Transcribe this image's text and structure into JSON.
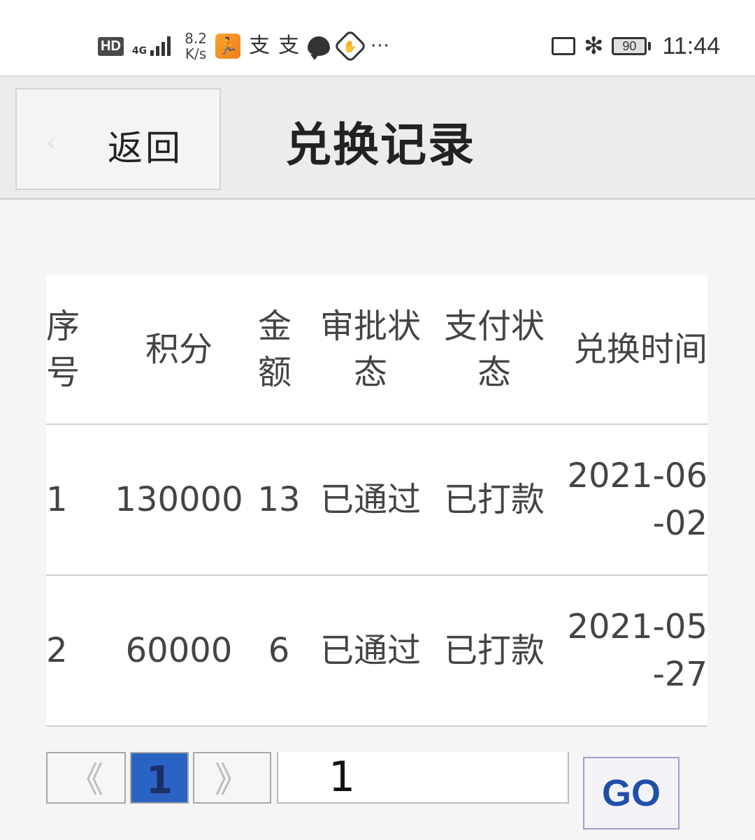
{
  "status_bar": {
    "hd": "HD",
    "network": "4G",
    "net_speed_value": "8.2",
    "net_speed_unit": "K/s",
    "app_glyph_1": "支",
    "app_glyph_2": "支",
    "more": "···",
    "battery": "90",
    "time": "11:44",
    "icons": [
      "hd-icon",
      "signal-icon",
      "running-app-icon",
      "alipay-icon",
      "alipay-icon",
      "chat-icon",
      "hand-icon",
      "more-icon",
      "cast-icon",
      "bluetooth-icon",
      "battery-icon"
    ]
  },
  "header": {
    "back_label": "返回",
    "title": "兑换记录"
  },
  "table": {
    "columns": [
      "序号",
      "积分",
      "金额",
      "审批状态",
      "支付状态",
      "兑换时间"
    ],
    "rows": [
      {
        "seq": "1",
        "points": "130000",
        "amount": "13",
        "approval": "已通过",
        "payment": "已打款",
        "time": "2021-06-02"
      },
      {
        "seq": "2",
        "points": "60000",
        "amount": "6",
        "approval": "已通过",
        "payment": "已打款",
        "time": "2021-05-27"
      }
    ]
  },
  "pagination": {
    "prev": "《",
    "current": "1",
    "next": "》",
    "input_value": "1",
    "go_label": "GO"
  },
  "colors": {
    "accent": "#2a63c4",
    "go_text": "#1f4fa8",
    "header_bg": "#ececec",
    "page_bg": "#f5f5f5"
  }
}
